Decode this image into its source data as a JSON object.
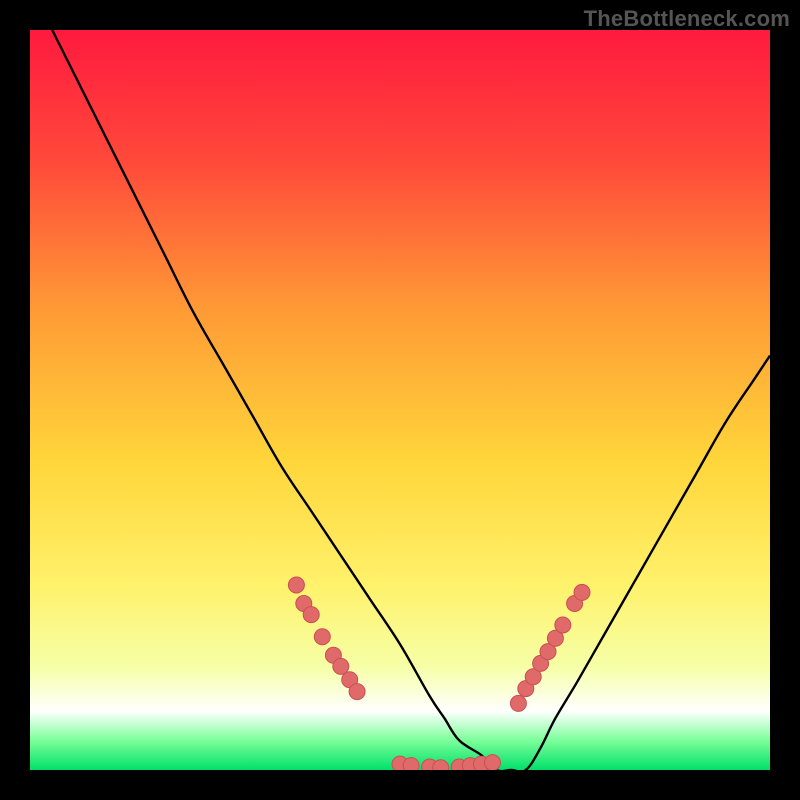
{
  "watermark": "TheBottleneck.com",
  "colors": {
    "page_bg": "#000000",
    "grad_top": "#ff1a3f",
    "grad_mid_upper": "#ff6b3d",
    "grad_mid": "#ffd53a",
    "grad_mid_lower": "#fff26b",
    "grad_low": "#f6ffa6",
    "grad_bottom_band": "#ffffff",
    "grad_green_top": "#7cff9a",
    "grad_green_bottom": "#00e06a",
    "curve": "#000000",
    "marker_fill": "#e06a6a",
    "marker_stroke": "#c85050"
  },
  "chart_data": {
    "type": "line",
    "title": "",
    "xlabel": "",
    "ylabel": "",
    "xlim": [
      0,
      100
    ],
    "ylim": [
      0,
      100
    ],
    "x": [
      3,
      6,
      10,
      14,
      18,
      22,
      26,
      30,
      34,
      38,
      42,
      46,
      50,
      54,
      56,
      58,
      61,
      63,
      65,
      67,
      69,
      71,
      74,
      78,
      82,
      86,
      90,
      94,
      98,
      100
    ],
    "values": [
      100,
      94,
      86,
      78,
      70,
      62,
      55,
      48,
      41,
      35,
      29,
      23,
      17,
      10,
      7,
      4,
      2,
      0,
      0,
      0,
      3,
      7,
      12,
      19,
      26,
      33,
      40,
      47,
      53,
      56
    ],
    "marker_points": [
      {
        "group": "left_descent",
        "x": 36.0,
        "y": 25.0
      },
      {
        "group": "left_descent",
        "x": 37.0,
        "y": 22.5
      },
      {
        "group": "left_descent",
        "x": 38.0,
        "y": 21.0
      },
      {
        "group": "left_descent",
        "x": 39.5,
        "y": 18.0
      },
      {
        "group": "left_descent",
        "x": 41.0,
        "y": 15.5
      },
      {
        "group": "left_descent",
        "x": 42.0,
        "y": 14.0
      },
      {
        "group": "left_descent",
        "x": 43.2,
        "y": 12.2
      },
      {
        "group": "left_descent",
        "x": 44.2,
        "y": 10.6
      },
      {
        "group": "trough",
        "x": 50.0,
        "y": 0.8
      },
      {
        "group": "trough",
        "x": 51.5,
        "y": 0.6
      },
      {
        "group": "trough",
        "x": 54.0,
        "y": 0.4
      },
      {
        "group": "trough",
        "x": 55.5,
        "y": 0.3
      },
      {
        "group": "trough",
        "x": 58.0,
        "y": 0.4
      },
      {
        "group": "trough",
        "x": 59.5,
        "y": 0.6
      },
      {
        "group": "trough",
        "x": 61.0,
        "y": 0.8
      },
      {
        "group": "trough",
        "x": 62.5,
        "y": 1.0
      },
      {
        "group": "right_ascent",
        "x": 66.0,
        "y": 9.0
      },
      {
        "group": "right_ascent",
        "x": 67.0,
        "y": 11.0
      },
      {
        "group": "right_ascent",
        "x": 68.0,
        "y": 12.6
      },
      {
        "group": "right_ascent",
        "x": 69.0,
        "y": 14.4
      },
      {
        "group": "right_ascent",
        "x": 70.0,
        "y": 16.0
      },
      {
        "group": "right_ascent",
        "x": 71.0,
        "y": 17.8
      },
      {
        "group": "right_ascent",
        "x": 72.0,
        "y": 19.6
      },
      {
        "group": "right_ascent",
        "x": 73.6,
        "y": 22.5
      },
      {
        "group": "right_ascent",
        "x": 74.6,
        "y": 24.0
      }
    ]
  }
}
